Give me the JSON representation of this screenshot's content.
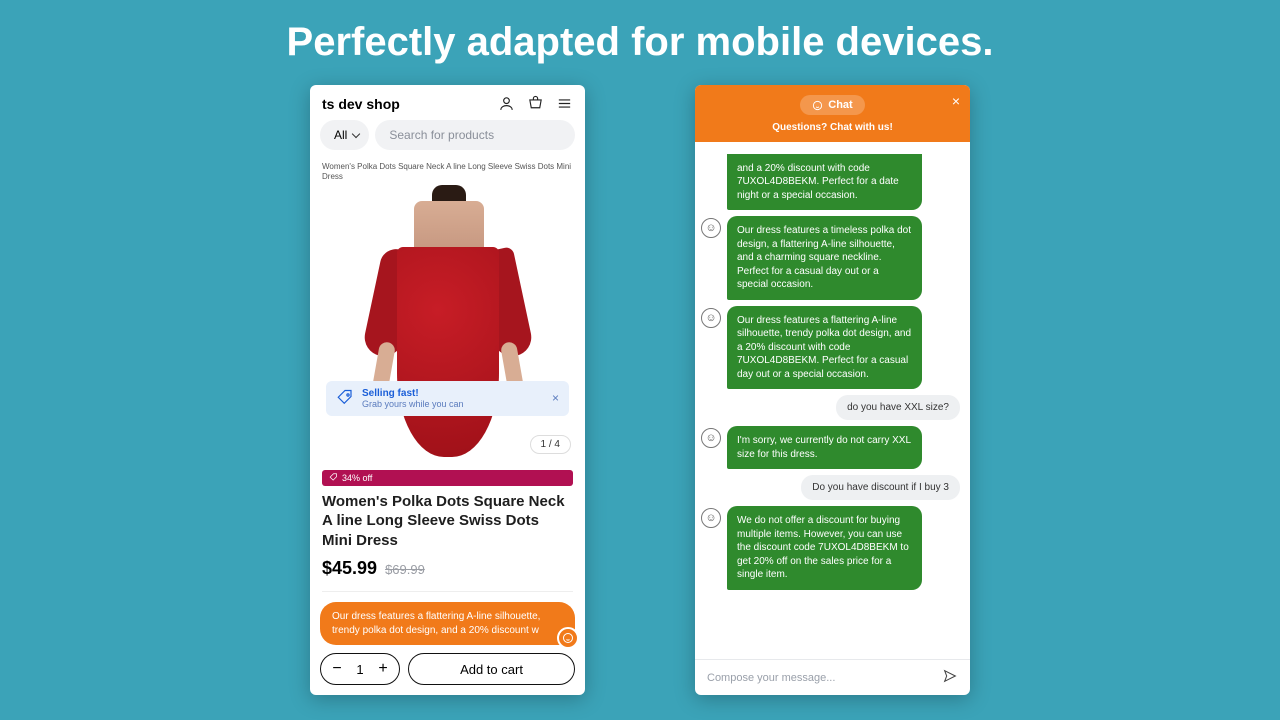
{
  "headline": "Perfectly adapted for mobile devices.",
  "shop": {
    "name": "ts dev shop",
    "filter_label": "All",
    "search_placeholder": "Search for products",
    "breadcrumb": "Women's Polka Dots Square Neck A line Long Sleeve Swiss Dots Mini Dress",
    "banner": {
      "title": "Selling fast!",
      "sub": "Grab yours while you can"
    },
    "img_counter": "1 / 4",
    "discount_badge": "34% off",
    "title": "Women's Polka Dots Square Neck A line Long Sleeve Swiss Dots Mini Dress",
    "price_now": "$45.99",
    "price_was": "$69.99",
    "chat_teaser": "Our dress features a flattering A-line silhouette, trendy polka dot design, and a 20% discount w",
    "qty": "1",
    "add_to_cart": "Add to cart"
  },
  "chat": {
    "chip": "Chat",
    "sub": "Questions? Chat with us!",
    "msgs": {
      "b0": "and a 20% discount with code 7UXOL4D8BEKM. Perfect for a date night or a special occasion.",
      "b1": "Our dress features a timeless polka dot design, a flattering A-line silhouette, and a charming square neckline. Perfect for a casual day out or a special occasion.",
      "b2": "Our dress features a flattering A-line silhouette, trendy polka dot design, and a 20% discount with code 7UXOL4D8BEKM. Perfect for a casual day out or a special occasion.",
      "u1": "do you have XXL size?",
      "b3": "I'm sorry, we currently do not carry XXL size for this dress.",
      "u2": "Do you have discount if I buy 3",
      "b4": "We do not offer a discount for buying multiple items. However, you can use the discount code 7UXOL4D8BEKM to get 20% off on the sales price for a single item."
    },
    "compose_placeholder": "Compose your message..."
  }
}
